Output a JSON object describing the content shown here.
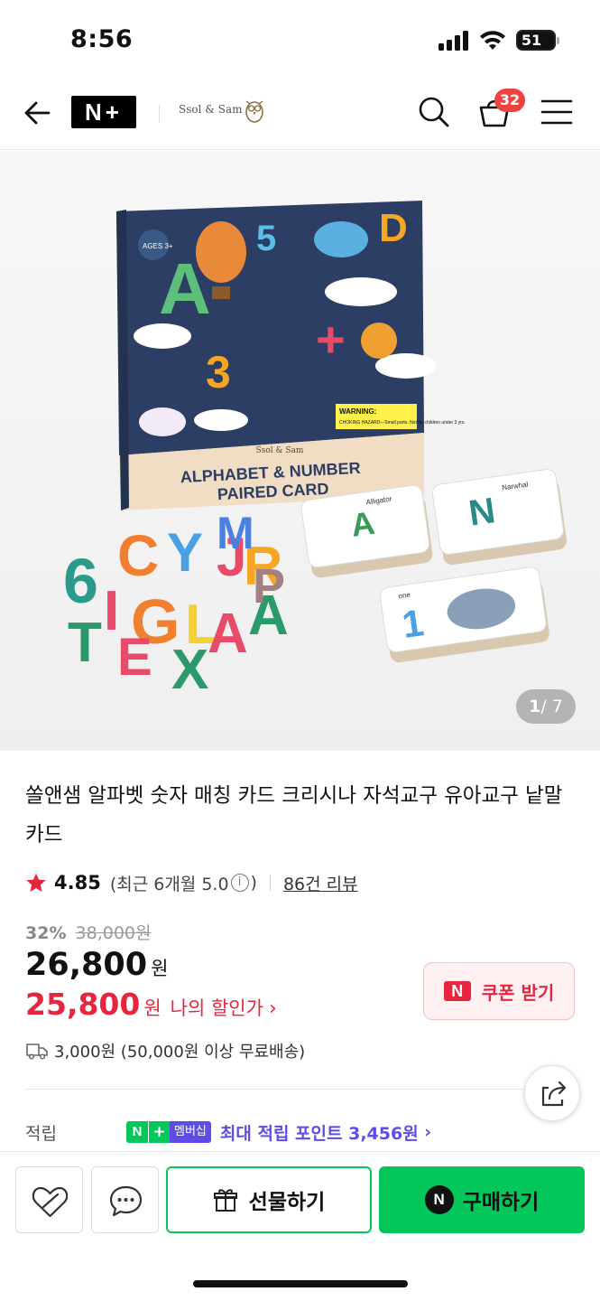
{
  "status_bar": {
    "time": "8:56",
    "battery": "51"
  },
  "header": {
    "store_name": "Ssol & Sam",
    "cart_count": "32"
  },
  "gallery": {
    "current": "1",
    "total": "/ 7"
  },
  "box_art": {
    "title_line1": "ALPHABET & NUMBER",
    "title_line2": "PAIRED CARD",
    "ages": "AGES 3+",
    "brand": "Ssol & Sam",
    "warning": "WARNING:",
    "warning_detail": "CHOKING HAZARD—Small parts. Not for children under 3 yrs."
  },
  "card_labels": {
    "alligator": "Alligator",
    "narwhal": "Narwhal",
    "one": "one"
  },
  "product": {
    "title": "쏠앤샘 알파벳 숫자 매칭 카드 크리시나 자석교구 유아교구 낱말카드",
    "rating": "4.85",
    "rating_recent_prefix": "(최근 6개월 5.0",
    "rating_recent_suffix": ")",
    "review_count": "86건 리뷰",
    "discount_rate": "32%",
    "original_price": "38,000원",
    "price": "26,800",
    "price_unit": "원",
    "benefit_price": "25,800",
    "benefit_unit": "원",
    "benefit_label": "나의 할인가",
    "coupon_label": "쿠폰 받기",
    "shipping": "3,000원 (50,000원 이상 무료배송)",
    "points_label": "적립",
    "membership_label": "멤버십",
    "points_text": "최대 적립 포인트 3,456원"
  },
  "bottom_bar": {
    "gift_label": "선물하기",
    "buy_label": "구매하기"
  },
  "colors": {
    "naver_green": "#03c75a",
    "sale_red": "#e8243f",
    "membership_purple": "#5d4de6"
  }
}
